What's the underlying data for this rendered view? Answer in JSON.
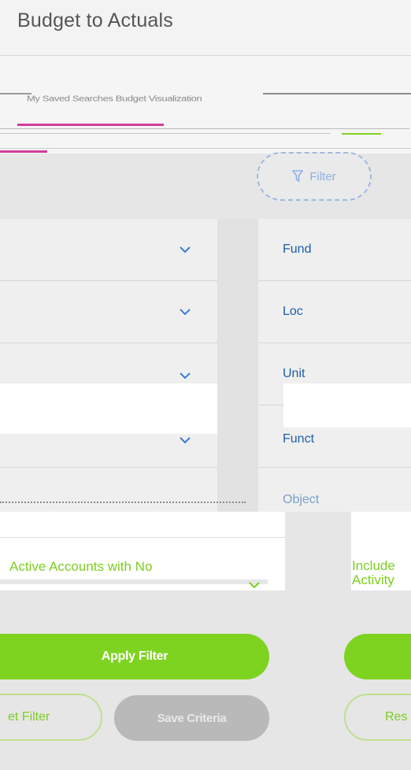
{
  "header": {
    "title": "Budget to Actuals"
  },
  "breadcrumb": {
    "scrambled": "My Saved Searches  Budget Visualization"
  },
  "toolbar": {
    "filter_label": "Filter"
  },
  "filters": {
    "fields": [
      "Fund",
      "Loc",
      "Unit",
      "Funct",
      "Object"
    ]
  },
  "options": {
    "left_label": "Active Accounts with No",
    "right_label_line1": "Include",
    "right_label_line2": "Activity"
  },
  "actions": {
    "apply": "Apply Filter",
    "reset": "et Filter",
    "save": "Save Criteria",
    "reset_right": "Res"
  },
  "colors": {
    "accent_green": "#7ed321",
    "link_blue": "#1b5ea8"
  }
}
